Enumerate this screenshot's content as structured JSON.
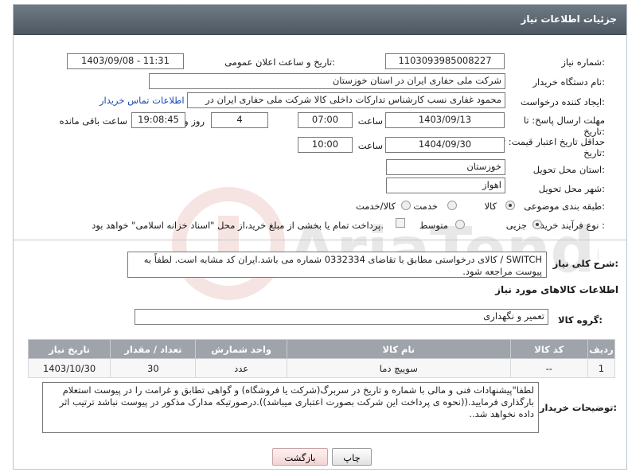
{
  "header": {
    "title": "جزئیات اطلاعات نیاز"
  },
  "form": {
    "need_number_label": "شماره نیاز:",
    "need_number": "1103093985008227",
    "announce_label": "تاریخ و ساعت اعلان عمومی:",
    "announce_value": "1403/09/08 - 11:31",
    "buyer_label": "نام دستگاه خریدار:",
    "buyer_value": "شرکت ملی حفاری ایران در استان خوزستان",
    "creator_label": "ایجاد کننده درخواست:",
    "creator_value": "محمود غفاری نسب کارشناس تدارکات داخلی  کالا شرکت ملی حفاری ایران در",
    "contact_link": "اطلاعات تماس خریدار",
    "deadline_label": "مهلت ارسال پاسخ: تا تاریخ:",
    "deadline_date": "1403/09/13",
    "time_label": "ساعت",
    "deadline_time": "07:00",
    "days_value": "4",
    "days_label": "روز و",
    "remaining_time": "19:08:45",
    "remaining_label": "ساعت باقی مانده",
    "validity_label": "حداقل تاریخ اعتبار قیمت: تا تاریخ:",
    "validity_date": "1404/09/30",
    "validity_time": "10:00",
    "province_label": "استان محل تحویل:",
    "province_value": "خوزستان",
    "city_label": "شهر محل تحویل:",
    "city_value": "اهواز",
    "category_label": "طبقه بندی موضوعی:",
    "category_options": [
      "کالا",
      "خدمت",
      "کالا/خدمت"
    ],
    "category_selected": "کالا",
    "process_label": "نوع فرآیند خرید :",
    "process_options": [
      "جزیی",
      "متوسط"
    ],
    "process_note": "پرداخت تمام یا بخشی از مبلغ خرید،از محل \"اسناد خزانه اسلامی\" خواهد بود."
  },
  "description": {
    "label": "شرح کلی نیاز:",
    "text": "SWITCH / کالای درخواستی مطابق با تقاضای 0332334 شماره می باشد.ایران کد مشابه است. لطفاً به پیوست مراجعه شود."
  },
  "goods": {
    "section_title": "اطلاعات کالاهای مورد نیاز",
    "group_label": "گروه کالا:",
    "group_value": "تعمیر و نگهداری",
    "table": {
      "headers": [
        "ردیف",
        "کد کالا",
        "نام کالا",
        "واحد شمارش",
        "تعداد / مقدار",
        "تاریخ نیاز"
      ],
      "rows": [
        [
          "1",
          "--",
          "سوییچ دما",
          "عدد",
          "30",
          "1403/10/30"
        ]
      ]
    }
  },
  "buyer_notes": {
    "label": "توضیحات خریدار:",
    "text": "لطفا\"پیشنهادات فنی و مالی با شماره و تاریخ در سربرگ(شرکت یا فروشگاه) و گواهی تطابق و غرامت را در پیوست استعلام بارگذاری فرمایید.((نحوه ی پرداخت این شرکت بصورت اعتباری میباشد)).درصورتیکه مدارک مذکور در پیوست نباشد ترتیب اثر داده نخواهد شد.."
  },
  "buttons": {
    "print": "چاپ",
    "back": "بازگشت"
  },
  "watermark": {
    "text": "AriaTender.neT"
  }
}
